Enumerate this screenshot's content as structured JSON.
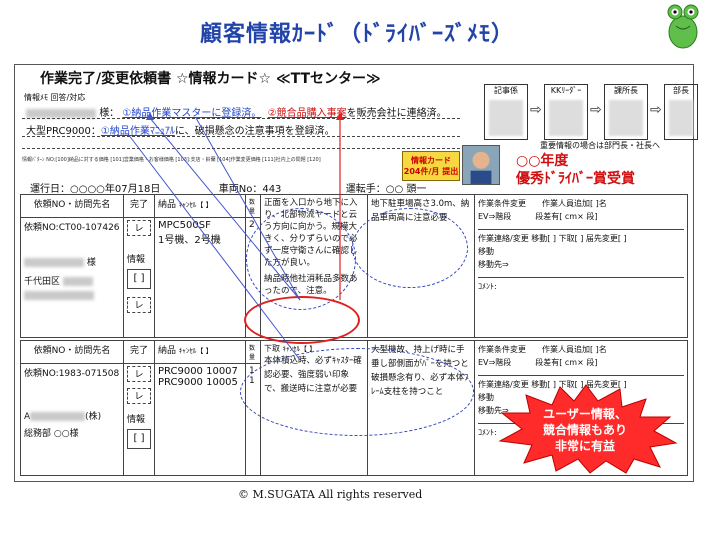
{
  "title": "顧客情報ｶｰﾄﾞ（ﾄﾞﾗｲﾊﾞｰｽﾞﾒﾓ）",
  "card_header": "作業完了/変更依頼書 ☆情報カード☆ ≪TTセンター≫",
  "memo": {
    "label": "情報ﾒﾓ 回答/対応",
    "line1_suffix": "様：",
    "line1_item1": "①納品作業マスターに登録済。",
    "line1_item2_red": "②競合品購入事案",
    "line1_item2_rest": "を販売会社に連絡済。",
    "line2_prefix": "大型PRC9000：",
    "line2_blue": "①納品作業ﾏﾆｭｱﾙ",
    "line2_rest": "に、破損懸念の注意事項を登録済。"
  },
  "info_bar": "情報ﾊﾟﾀｰﾝ NO:[100]納品に対する価格 [101]営業価格・お客様価格 [103]:支店・鈴蘭 [104]作業変更価格 [111]社内上の問題 [120]",
  "approvals": {
    "labels": [
      "記事係",
      "KKﾘｰﾀﾞｰ",
      "課所長",
      "部長"
    ],
    "note": "重要情報の場合は部門長・社長へ"
  },
  "award": {
    "bubble_line1": "情報カード",
    "bubble_line2": "204件/月 提出",
    "line1": "○○年度",
    "line2": "優秀ﾄﾞﾗｲﾊﾞｰ賞受賞"
  },
  "run_info": {
    "date": "運行日：○○○○年07月18日",
    "vehicle": "車両No：443",
    "driver": "運転手：○○ 頭一"
  },
  "rows": [
    {
      "header_dest": "依頼NO・訪問先名",
      "header_done": "完了",
      "header_deliv": "納品",
      "header_cancel": "ｷｬﾝｾﾙ【 】",
      "header_num": "数量",
      "req_no": "依頼NO:CT00-107426",
      "customer_suffix": "様",
      "address": "千代田区",
      "model": "MPC500SF",
      "model_sub": "1号機、2号機",
      "qty": "2",
      "note_col1": "正面を入口から地下に入り、北部物流ヤードと云う方向に向かう。規模大きく、分りずらいので必ず一度守衛さんに確認した方が良い。",
      "note_col1_circled": "納品時他社消耗品多数あったので、注意。",
      "note_col2": "地下駐車場高さ3.0m、納品車両高に注意必要",
      "right_line1": "作業条件変更　　作業人員追加[ ]名",
      "right_line2": "EV⇒階段　　　段差有[ cm× 段]",
      "right_line3": "作業連絡/変更 移動[ ] 下取[ ] 届先変更[ ]",
      "right_line4": "移動",
      "right_line5": "移動先⇒",
      "right_comment": "ｺﾒﾝﾄ:"
    },
    {
      "header_dest": "依頼NO・訪問先名",
      "header_done": "完了",
      "header_deliv": "納品",
      "header_cancel": "ｷｬﾝｾﾙ【 】",
      "header_num": "数量",
      "header_swap": "下取",
      "req_no": "依頼NO:1983-071508",
      "customer_prefix": "A",
      "customer_suffix": "(株)",
      "dept": "総務部 ○○様",
      "model": "PRC9000 10007",
      "model_sub": "PRC9000 10005",
      "qty1": "1",
      "qty2": "1",
      "note_col1": "本体積込時、必ずｷｬｽﾀｰ確認必要、強度弱い印象で、搬送時に注意が必要",
      "note_col2": "大型機故、持上げ時に手垂し部側面がﾊﾞｰを持つと破損懸念有り、必ず本体ﾌﾚｰﾑ支柱を持つこと",
      "right_line1": "作業条件変更　　作業人員追加[ ]名",
      "right_line2": "EV⇒階段　　　段差有[ cm× 段]",
      "right_line3": "作業連絡/変更 移動[ ] 下取[ ] 届先変更[ ]",
      "right_line4": "移動",
      "right_line5": "移動先⇒",
      "right_comment": "ｺﾒﾝﾄ:"
    }
  ],
  "left_labels": {
    "check": "レ",
    "info": "情報",
    "bracket": "[ ]"
  },
  "callout": {
    "line1": "ユーザー情報、",
    "line2": "競合情報もあり",
    "line3": "非常に有益"
  },
  "copyright": "© M.SUGATA All rights reserved",
  "colors": {
    "title": "#2244aa",
    "highlight_red": "#d01010",
    "highlight_blue": "#2244cc",
    "callout_fill": "#ff2a2a"
  }
}
